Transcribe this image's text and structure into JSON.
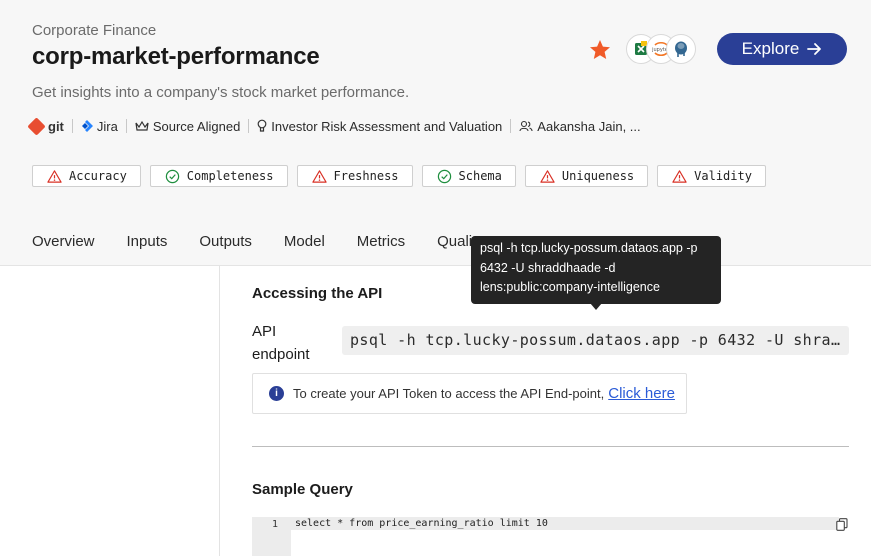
{
  "product": {
    "category": "Corporate Finance",
    "title": "corp-market-performance",
    "description": "Get insights into a company's stock market performance."
  },
  "meta": {
    "git": "git",
    "jira": "Jira",
    "alignment": "Source Aligned",
    "use_case": "Investor Risk Assessment and Valuation",
    "owners": "Aakansha Jain, ..."
  },
  "quality_badges": [
    {
      "label": "Accuracy",
      "status": "warning"
    },
    {
      "label": "Completeness",
      "status": "pass"
    },
    {
      "label": "Freshness",
      "status": "warning"
    },
    {
      "label": "Schema",
      "status": "pass"
    },
    {
      "label": "Uniqueness",
      "status": "warning"
    },
    {
      "label": "Validity",
      "status": "warning"
    }
  ],
  "actions": {
    "explore_label": "Explore"
  },
  "tabs": [
    "Overview",
    "Inputs",
    "Outputs",
    "Model",
    "Metrics",
    "Quality"
  ],
  "api": {
    "section_title": "Accessing the API",
    "endpoint_label": "API endpoint",
    "endpoint_value": "psql -h tcp.lucky-possum.dataos.app -p 6432 -U shraddhaade -d lens:public:company-intelligence",
    "token_text": "To create your API Token to access the API End-point,",
    "token_link": "Click here"
  },
  "tooltip": {
    "text": "psql -h tcp.lucky-possum.dataos.app -p 6432 -U shraddhaade -d lens:public:company-intelligence"
  },
  "sample_query": {
    "title": "Sample Query",
    "line_number": "1",
    "code": "select * from price_earning_ratio limit 10"
  },
  "colors": {
    "brand": "#2a3f96",
    "warning": "#d93025",
    "pass": "#1e8e3e",
    "star": "#f05a28"
  }
}
